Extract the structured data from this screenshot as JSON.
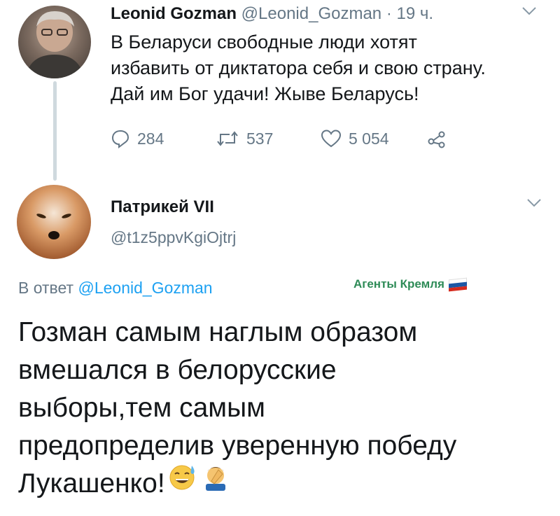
{
  "tweet1": {
    "author_name": "Leonid Gozman",
    "author_handle": "@Leonid_Gozman",
    "separator": " · ",
    "time": "19 ч.",
    "text_lines": [
      "В Беларуси свободные люди хотят",
      "избавить от диктатора себя и свою страну.",
      "Дай им Бог удачи! Жыве Беларусь!"
    ],
    "replies": "284",
    "retweets": "537",
    "likes": "5 054",
    "icons": [
      "reply-icon",
      "retweet-icon",
      "like-icon",
      "share-icon"
    ]
  },
  "tweet2": {
    "author_name": "Патрикей VII",
    "author_handle": "@t1z5ppvKgiOjtrj",
    "replying_prefix": "В ответ ",
    "replying_to": "@Leonid_Gozman",
    "text_lines": [
      "Гозман самым наглым образом",
      "вмешался в белорусские",
      "выборы,тем самым",
      "предопределив уверенную победу",
      "Лукашенко!"
    ],
    "emojis": [
      "sweat-smile-emoji",
      "facepalm-emoji"
    ]
  },
  "watermark": {
    "text": "Агенты Кремля",
    "flag_colors": [
      "#ffffff",
      "#1c57a5",
      "#d52b1e"
    ]
  },
  "colors": {
    "text": "#14171a",
    "muted": "#657786",
    "link": "#1da1f2",
    "watermark": "#2e8b57"
  }
}
